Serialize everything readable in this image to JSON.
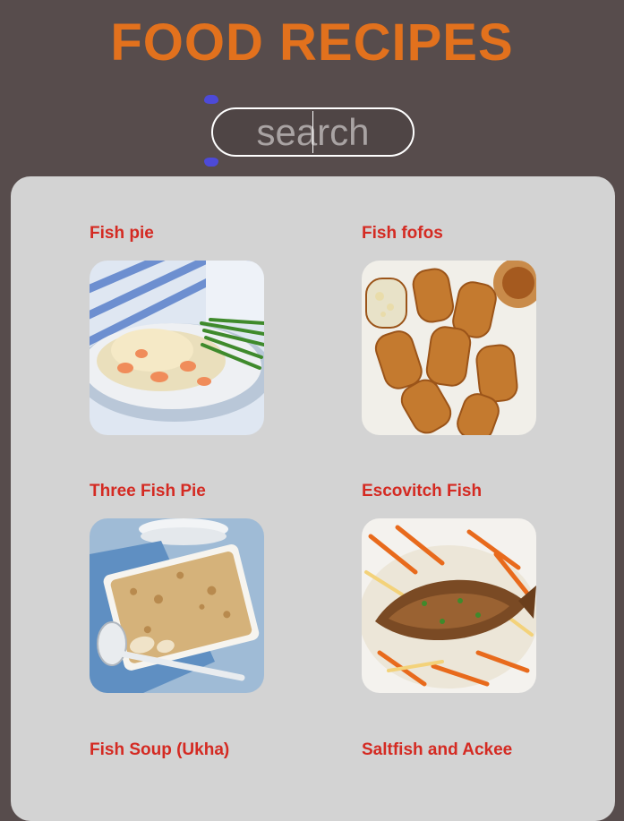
{
  "header": {
    "title": "FOOD RECIPES"
  },
  "search": {
    "placeholder": "search",
    "value": ""
  },
  "recipes": [
    {
      "title": "Fish pie",
      "image_icon": "fish-pie-photo"
    },
    {
      "title": "Fish fofos",
      "image_icon": "fish-fofos-photo"
    },
    {
      "title": "Three Fish Pie",
      "image_icon": "three-fish-pie-photo"
    },
    {
      "title": "Escovitch Fish",
      "image_icon": "escovitch-fish-photo"
    },
    {
      "title": "Fish Soup (Ukha)",
      "image_icon": "fish-soup-photo"
    },
    {
      "title": "Saltfish and Ackee",
      "image_icon": "saltfish-ackee-photo"
    }
  ],
  "colors": {
    "background": "#574c4c",
    "title": "#e2711d",
    "panel": "#d3d3d3",
    "recipe_title": "#d42a22",
    "selection_handle": "#4d4ad8"
  }
}
